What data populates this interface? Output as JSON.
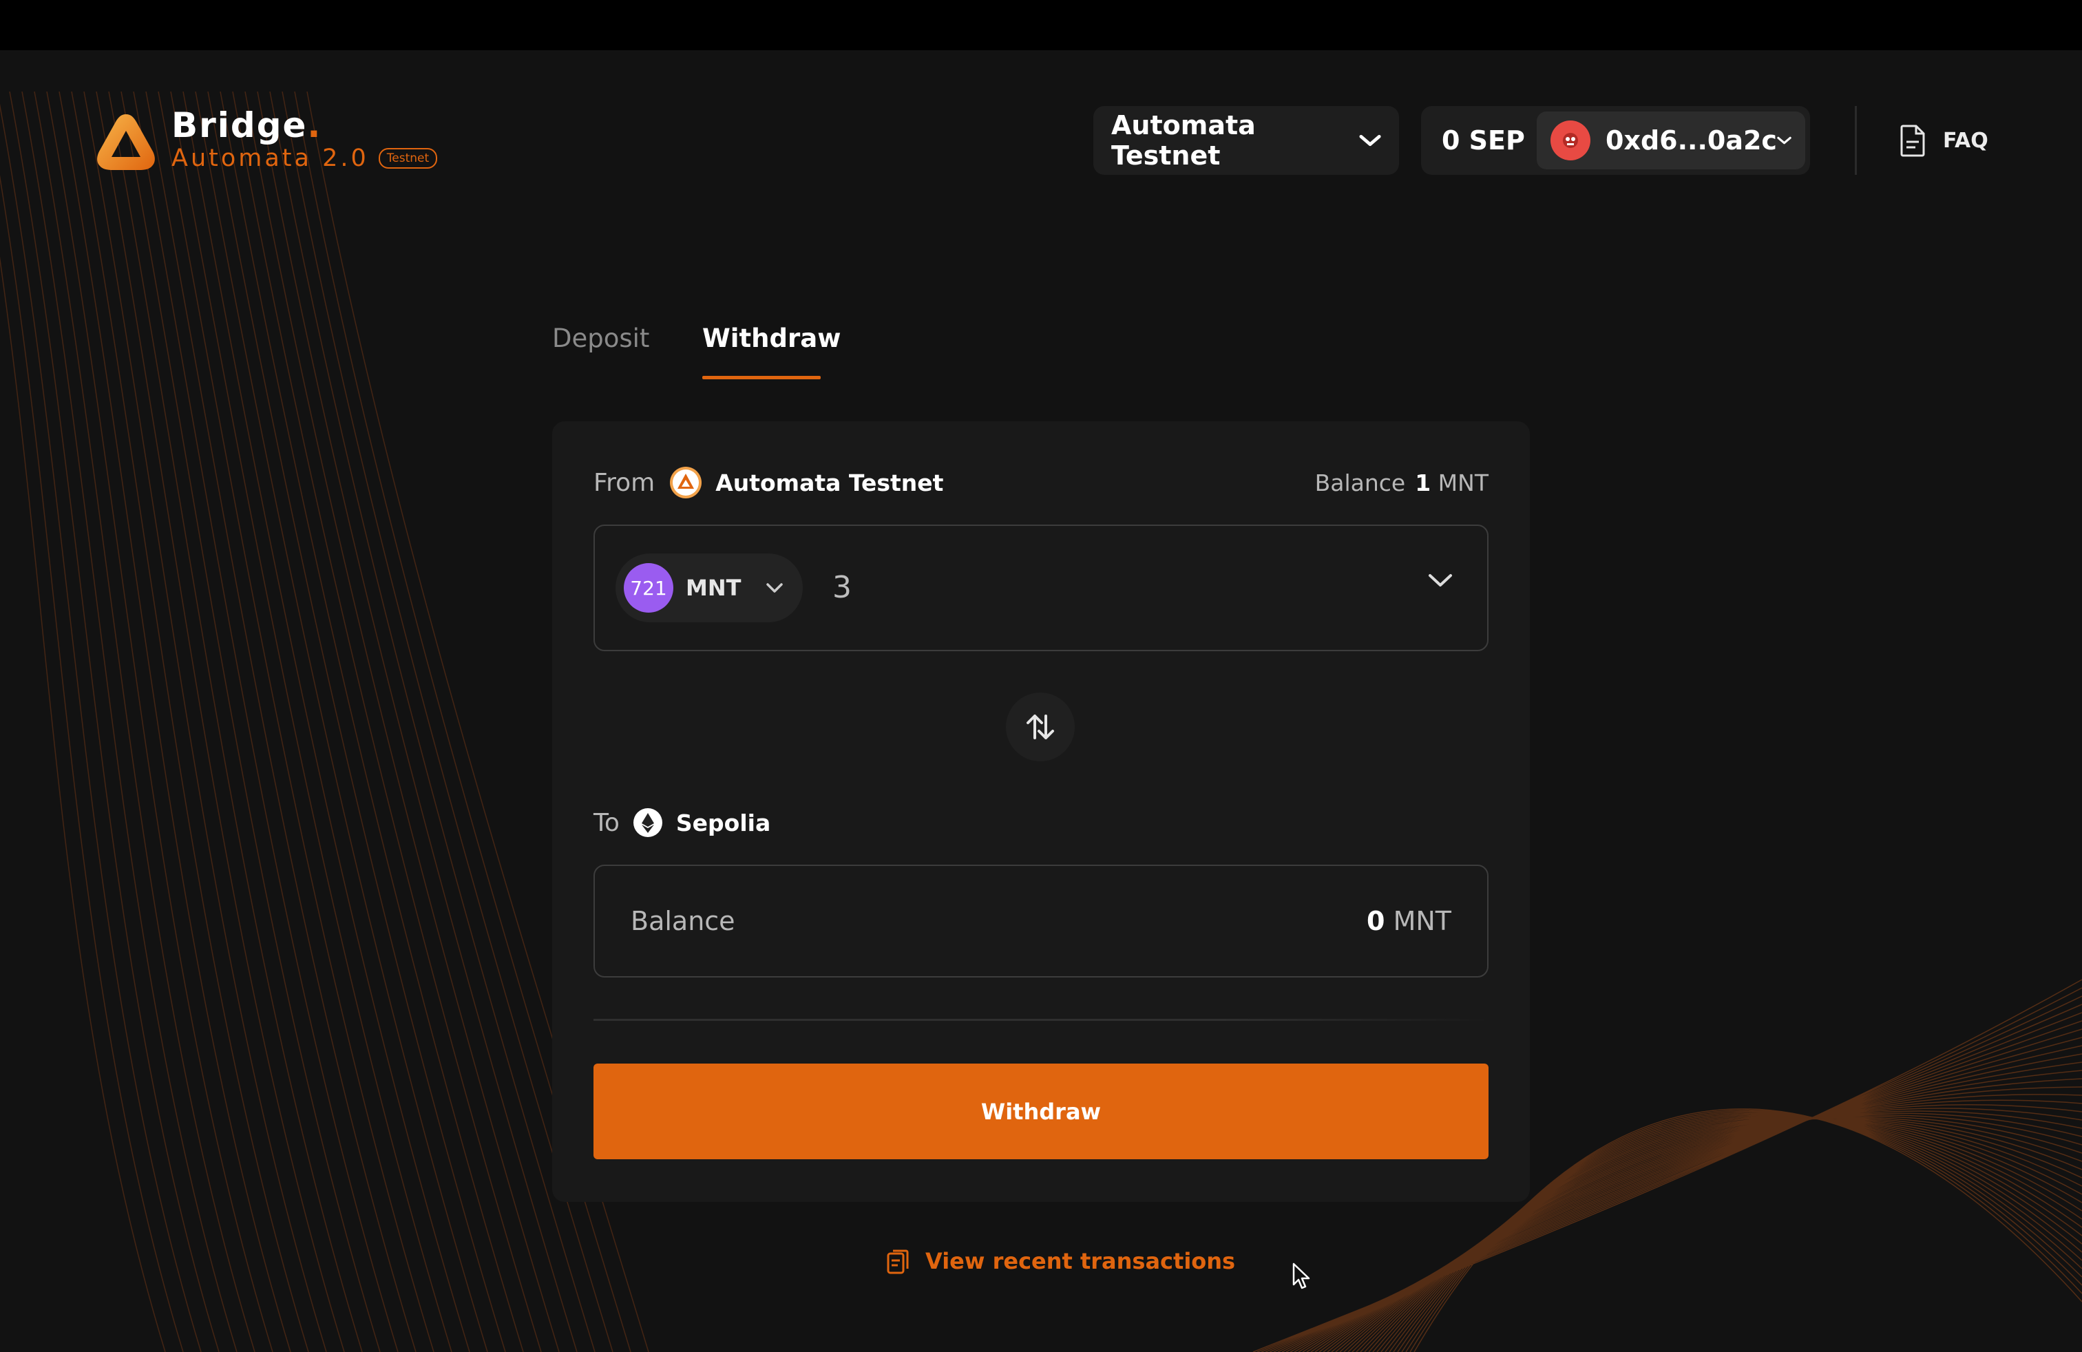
{
  "header": {
    "brand_title": "Bridge",
    "brand_dot": ".",
    "brand_subtitle": "Automata 2.0",
    "testnet_badge": "Testnet",
    "network_selector": "Automata Testnet",
    "wallet_balance": "0 SEP",
    "wallet_address": "0xd6...0a2c",
    "faq_label": "FAQ"
  },
  "tabs": [
    {
      "label": "Deposit",
      "active": false
    },
    {
      "label": "Withdraw",
      "active": true
    }
  ],
  "from": {
    "label": "From",
    "network": "Automata Testnet",
    "balance_label": "Balance",
    "balance_value": "1",
    "balance_unit": "MNT",
    "token_symbol": "MNT",
    "token_icon_text": "721",
    "amount": "3"
  },
  "to": {
    "label": "To",
    "network": "Sepolia",
    "balance_label": "Balance",
    "balance_value": "0",
    "balance_unit": "MNT"
  },
  "actions": {
    "withdraw_button": "Withdraw",
    "recent_transactions": "View recent transactions"
  },
  "colors": {
    "accent": "#e0650f",
    "background": "#121212",
    "card": "#191919",
    "token_icon": "#9a5cf0",
    "avatar": "#e84a43"
  },
  "icons": [
    "automata-logo-icon",
    "chevron-down-icon",
    "avatar-icon",
    "document-icon",
    "swap-arrows-icon",
    "ethereum-icon",
    "clipboard-icon",
    "cursor-icon"
  ]
}
